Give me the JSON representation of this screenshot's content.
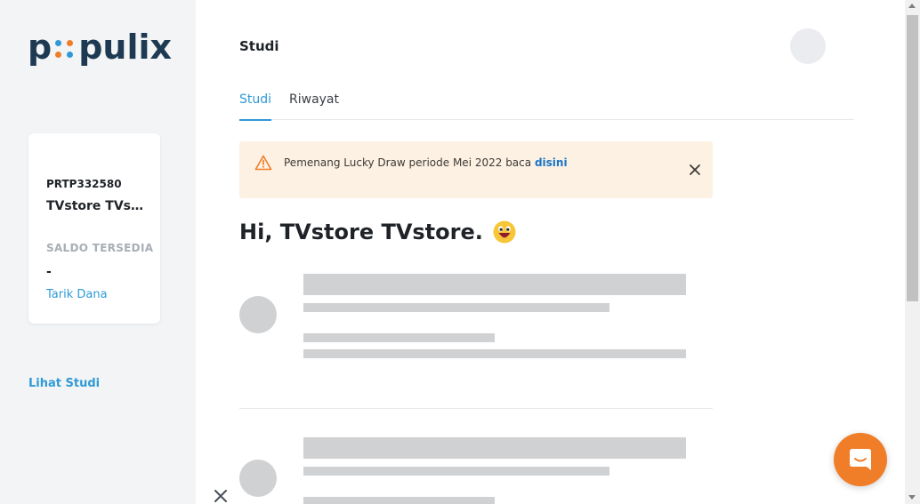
{
  "brand": {
    "logo_prefix": "p",
    "logo_suffix": "pulix",
    "logo_color": "#1e3a52",
    "dot_colors": [
      "#2f9ad6",
      "#f07d28",
      "#f07d28",
      "#2f9ad6"
    ]
  },
  "account": {
    "id": "PRTP332580",
    "name": "TVstore TVst...",
    "balance_label": "SALDO TERSEDIA",
    "balance": "-",
    "withdraw_label": "Tarik Dana"
  },
  "sidebar": {
    "view_studies_label": "Lihat Studi"
  },
  "header": {
    "title": "Studi"
  },
  "tabs": [
    {
      "label": "Studi",
      "active": true
    },
    {
      "label": "Riwayat",
      "active": false
    }
  ],
  "alert": {
    "icon": "warning-triangle-icon",
    "text": "Pemenang Lucky Draw periode Mei 2022 baca ",
    "link_text": "disini",
    "color": "#f07d28"
  },
  "greeting": {
    "text": "Hi, TVstore TVstore.",
    "emoji_icon": "grinning-face-icon"
  },
  "colors": {
    "accent": "#2f9ad6",
    "chat_button": "#f07d28",
    "skeleton": "#cfd1d3"
  },
  "chat": {
    "icon": "chat-bubble-icon"
  }
}
